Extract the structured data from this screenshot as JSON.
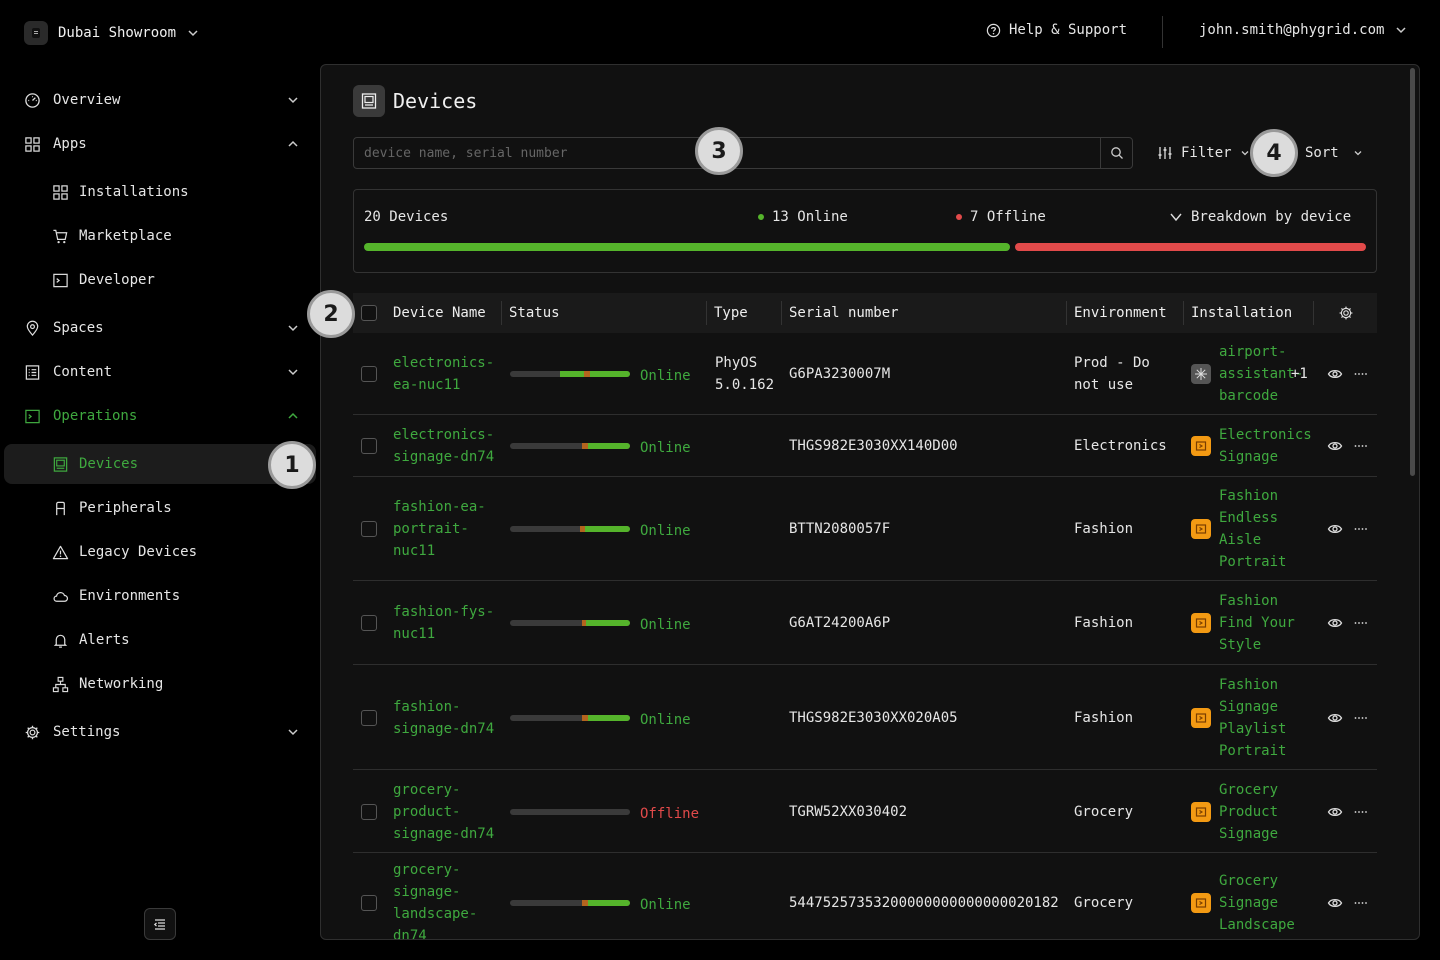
{
  "topbar": {
    "org_name": "Dubai Showroom",
    "help_label": "Help & Support",
    "user_email": "john.smith@phygrid.com"
  },
  "sidebar": {
    "overview": "Overview",
    "apps": "Apps",
    "installations": "Installations",
    "marketplace": "Marketplace",
    "developer": "Developer",
    "spaces": "Spaces",
    "content": "Content",
    "operations": "Operations",
    "devices": "Devices",
    "peripherals": "Peripherals",
    "legacy_devices": "Legacy Devices",
    "environments": "Environments",
    "alerts": "Alerts",
    "networking": "Networking",
    "settings": "Settings"
  },
  "markers": [
    "1",
    "2",
    "3",
    "4"
  ],
  "page": {
    "title": "Devices",
    "search_placeholder": "device name, serial number",
    "filter_label": "Filter",
    "sort_label": "Sort"
  },
  "summary": {
    "total": "20 Devices",
    "online": "13 Online",
    "offline": "7 Offline",
    "breakdown": "Breakdown by device",
    "online_fraction": 0.65
  },
  "table": {
    "columns": [
      "Device Name",
      "Status",
      "Type",
      "Serial number",
      "Environment",
      "Installation"
    ],
    "rows": [
      {
        "name": "electronics-ea-nuc11",
        "status": "Online",
        "type": "PhyOS 5.0.162",
        "serial": "G6PA3230007M",
        "env": "Prod - Do not use",
        "installation": "airport-assistant-barcode",
        "extra": "+1"
      },
      {
        "name": "electronics-signage-dn74",
        "status": "Online",
        "type": "",
        "serial": "THGS982E3030XX140D00",
        "env": "Electronics",
        "installation": "Electronics Signage",
        "extra": ""
      },
      {
        "name": "fashion-ea-portrait-nuc11",
        "status": "Online",
        "type": "",
        "serial": "BTTN2080057F",
        "env": "Fashion",
        "installation": "Fashion Endless Aisle Portrait",
        "extra": ""
      },
      {
        "name": "fashion-fys-nuc11",
        "status": "Online",
        "type": "",
        "serial": "G6AT24200A6P",
        "env": "Fashion",
        "installation": "Fashion Find Your Style",
        "extra": ""
      },
      {
        "name": "fashion-signage-dn74",
        "status": "Online",
        "type": "",
        "serial": "THGS982E3030XX020A05",
        "env": "Fashion",
        "installation": "Fashion Signage Playlist Portrait",
        "extra": ""
      },
      {
        "name": "grocery-product-signage-dn74",
        "status": "Offline",
        "type": "",
        "serial": "TGRW52XX030402",
        "env": "Grocery",
        "installation": "Grocery Product Signage",
        "extra": ""
      },
      {
        "name": "grocery-signage-landscape-dn74",
        "status": "Online",
        "type": "",
        "serial": "54475257353200000000000000020182",
        "env": "Grocery",
        "installation": "Grocery Signage Landscape",
        "extra": ""
      }
    ]
  },
  "colors": {
    "accent_green": "#3fa93f",
    "online_bar": "#55b42b",
    "offline_red": "#e24a4a",
    "installation_orange": "#f39a13"
  }
}
